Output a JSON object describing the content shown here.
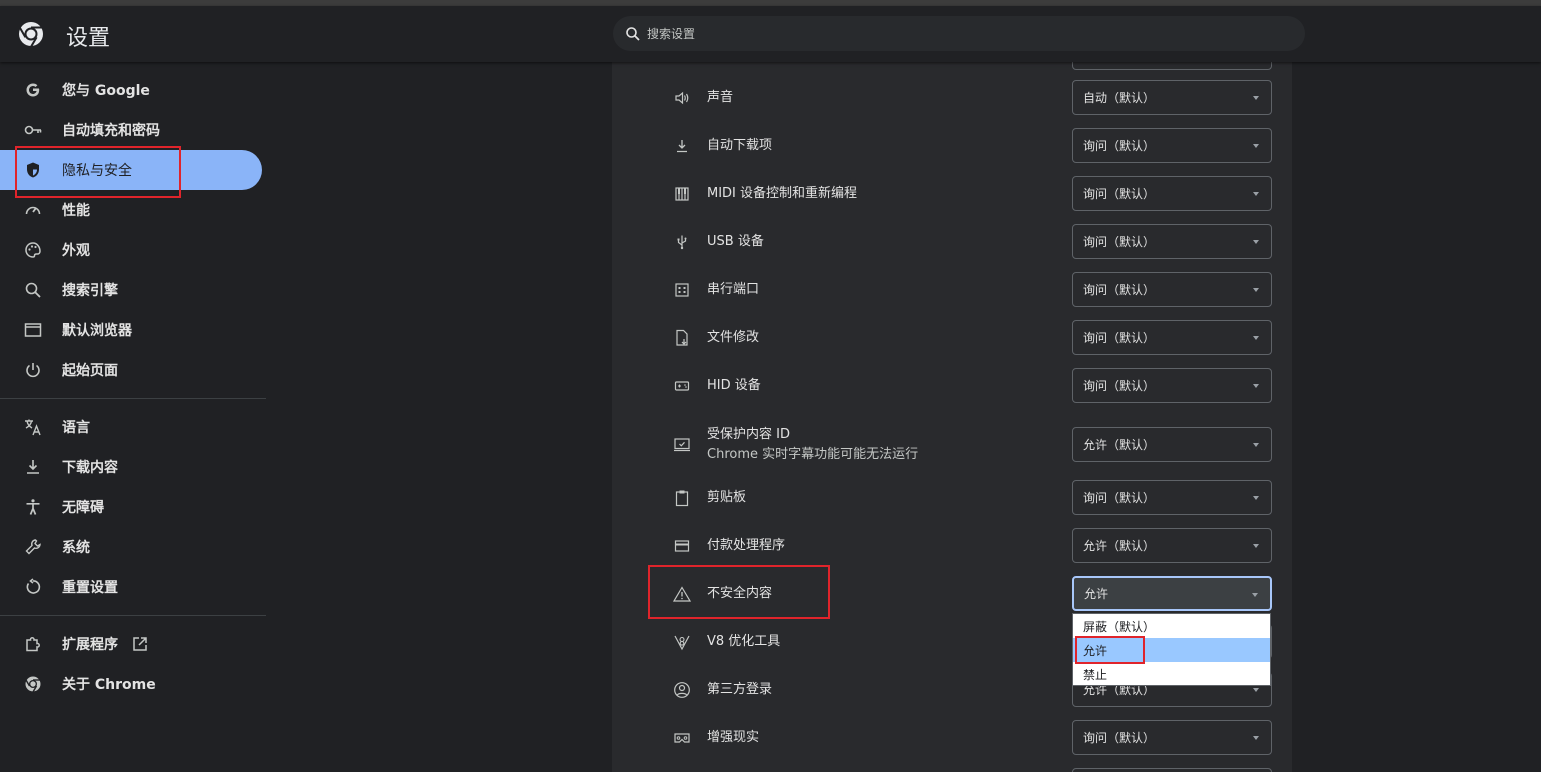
{
  "header": {
    "title": "设置",
    "search_placeholder": "搜索设置"
  },
  "sidebar": {
    "items": [
      {
        "label": "您与 Google",
        "icon": "google-g-icon"
      },
      {
        "label": "自动填充和密码",
        "icon": "key-icon"
      },
      {
        "label": "隐私与安全",
        "icon": "shield-icon",
        "active": true
      },
      {
        "label": "性能",
        "icon": "speedometer-icon"
      },
      {
        "label": "外观",
        "icon": "palette-icon"
      },
      {
        "label": "搜索引擎",
        "icon": "search-icon"
      },
      {
        "label": "默认浏览器",
        "icon": "browser-window-icon"
      },
      {
        "label": "起始页面",
        "icon": "power-icon"
      },
      {
        "label": "语言",
        "icon": "translate-icon"
      },
      {
        "label": "下载内容",
        "icon": "download-icon"
      },
      {
        "label": "无障碍",
        "icon": "accessibility-icon"
      },
      {
        "label": "系统",
        "icon": "wrench-icon"
      },
      {
        "label": "重置设置",
        "icon": "reset-icon"
      },
      {
        "label": "扩展程序",
        "icon": "puzzle-icon"
      },
      {
        "label": "关于 Chrome",
        "icon": "chrome-icon"
      }
    ]
  },
  "permissions": {
    "rows": [
      {
        "label": "声音",
        "value": "自动（默认）",
        "icon": "speaker-icon"
      },
      {
        "label": "自动下载项",
        "value": "询问（默认）",
        "icon": "download-icon"
      },
      {
        "label": "MIDI 设备控制和重新编程",
        "value": "询问（默认）",
        "icon": "piano-icon"
      },
      {
        "label": "USB 设备",
        "value": "询问（默认）",
        "icon": "usb-icon"
      },
      {
        "label": "串行端口",
        "value": "询问（默认）",
        "icon": "serial-port-icon"
      },
      {
        "label": "文件修改",
        "value": "询问（默认）",
        "icon": "file-edit-icon"
      },
      {
        "label": "HID 设备",
        "value": "询问（默认）",
        "icon": "hid-device-icon"
      },
      {
        "label": "受保护内容 ID",
        "sublabel": "Chrome 实时字幕功能可能无法运行",
        "value": "允许（默认）",
        "icon": "protected-content-icon"
      },
      {
        "label": "剪贴板",
        "value": "询问（默认）",
        "icon": "clipboard-icon"
      },
      {
        "label": "付款处理程序",
        "value": "允许（默认）",
        "icon": "credit-card-icon"
      },
      {
        "label": "不安全内容",
        "value": "允许",
        "icon": "warning-icon"
      },
      {
        "label": "V8 优化工具",
        "value": "",
        "icon": "v8-icon"
      },
      {
        "label": "第三方登录",
        "value": "允许（默认）",
        "icon": "account-circle-icon"
      },
      {
        "label": "增强现实",
        "value": "询问（默认）",
        "icon": "vr-headset-icon"
      }
    ],
    "dropdown_options": [
      "屏蔽（默认）",
      "允许",
      "禁止"
    ],
    "dropdown_selected": "允许"
  },
  "colors": {
    "accent": "#8ab4f8",
    "highlight_option": "#99c8ff",
    "annotation_red": "#e0242b"
  }
}
